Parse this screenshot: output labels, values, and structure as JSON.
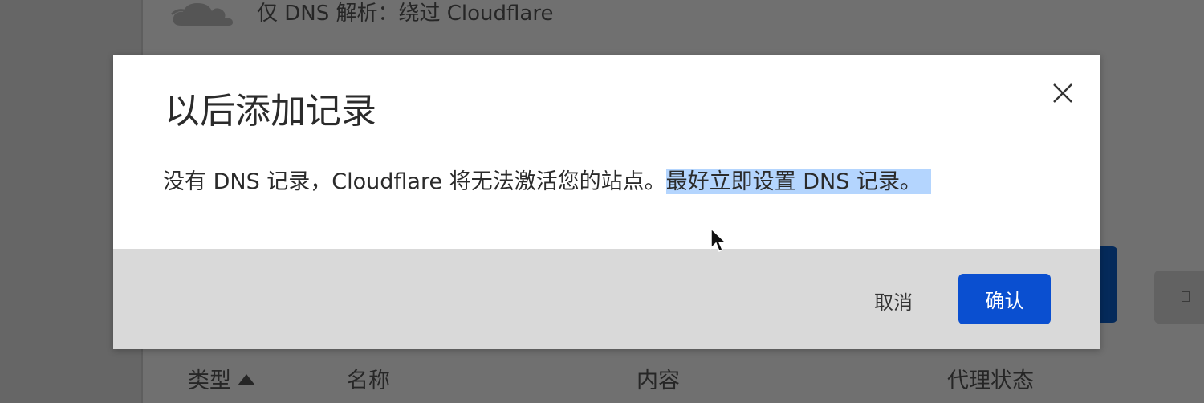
{
  "background": {
    "dns_only_label": "仅 DNS 解析：绕过 Cloudflare",
    "table_headers": {
      "type": "类型",
      "name": "名称",
      "content": "内容",
      "proxy_status": "代理状态"
    },
    "icons": {
      "cloud": "grey-cloud-icon",
      "sort": "sort-ascending-icon",
      "small_button": "document-icon"
    }
  },
  "modal": {
    "title": "以后添加记录",
    "message_part1": "没有 DNS 记录，Cloudflare 将无法激活您的站点。",
    "message_highlighted": "最好立即设置 DNS 记录。",
    "cancel_label": "取消",
    "confirm_label": "确认",
    "close_icon": "close-icon"
  },
  "colors": {
    "primary_button": "#0a4fd0",
    "selection_highlight": "#b4d5fe",
    "footer": "#d9d9d9",
    "overlay": "#707070"
  }
}
